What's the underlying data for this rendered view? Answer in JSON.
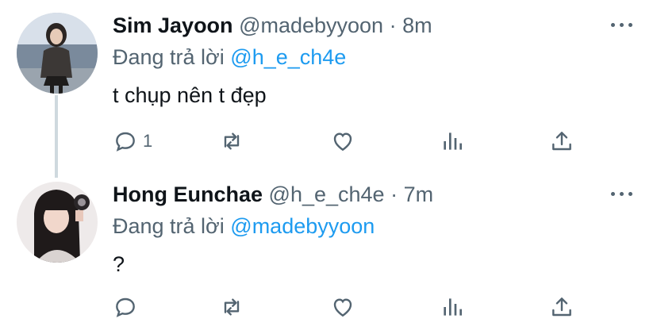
{
  "tweets": [
    {
      "name": "Sim Jayoon",
      "handle": "@madebyyoon",
      "separator": "·",
      "time": "8m",
      "reply_prefix": "Đang trả lời",
      "reply_to": "@h_e_ch4e",
      "text": "t chụp nên t đẹp",
      "reply_count": "1",
      "icons": [
        "reply-icon",
        "retweet-icon",
        "like-icon",
        "analytics-icon",
        "share-icon",
        "more-icon"
      ]
    },
    {
      "name": "Hong Eunchae",
      "handle": "@h_e_ch4e",
      "separator": "·",
      "time": "7m",
      "reply_prefix": "Đang trả lời",
      "reply_to": "@madebyyoon",
      "text": "?",
      "reply_count": "",
      "icons": [
        "reply-icon",
        "retweet-icon",
        "like-icon",
        "analytics-icon",
        "share-icon",
        "more-icon"
      ]
    }
  ],
  "colors": {
    "link": "#1d9bf0",
    "muted": "#536471",
    "text": "#0f1419",
    "thread_line": "#cfd9de"
  }
}
